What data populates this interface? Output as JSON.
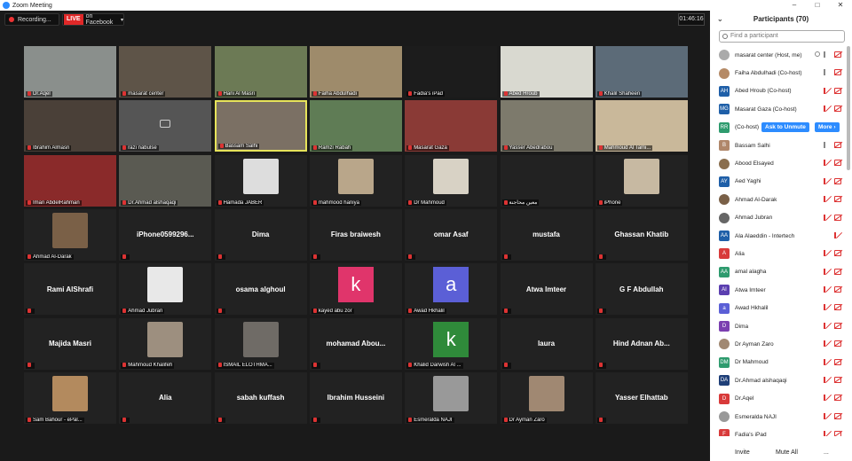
{
  "window": {
    "title": "Zoom Meeting",
    "controls": [
      "–",
      "□",
      "✕"
    ]
  },
  "topbar": {
    "recording": "Recording...",
    "live_tag": "LIVE",
    "live_target": "on Facebook",
    "timer": "01:46:16"
  },
  "tiles": [
    {
      "name": "Dr.Aqel",
      "type": "video",
      "color": "#8a8f8c"
    },
    {
      "name": "masarat center",
      "type": "video",
      "color": "#5e5448"
    },
    {
      "name": "Hani Al Masri",
      "type": "video",
      "color": "#6c7a55"
    },
    {
      "name": "Faiha Abdulhadi",
      "type": "video",
      "color": "#9e8b6b"
    },
    {
      "name": "Fadia's iPad",
      "type": "video",
      "color": "#1c1c1c"
    },
    {
      "name": "Abed Hroub",
      "type": "video",
      "color": "#d9d9d0"
    },
    {
      "name": "Khalil Shaheen",
      "type": "video",
      "color": "#5c6b78"
    },
    {
      "name": "Ibrahim Almasri",
      "type": "video",
      "color": "#4a4038"
    },
    {
      "name": "razi nabulse",
      "type": "camoff",
      "color": "#555"
    },
    {
      "name": "Bassam Salhi",
      "type": "video",
      "color": "#7b7064",
      "talking": true
    },
    {
      "name": "Ramzi Rabah",
      "type": "video",
      "color": "#5f7c55"
    },
    {
      "name": "Masarat Gaza",
      "type": "video",
      "color": "#8a3a36"
    },
    {
      "name": "Yasser Abedrabou",
      "type": "video",
      "color": "#7d7a6c"
    },
    {
      "name": "Mahmoud Al Tami...",
      "type": "video",
      "color": "#c9b89a"
    },
    {
      "name": "Iman AbdelRahman",
      "type": "video",
      "color": "#8a2a2a"
    },
    {
      "name": "Dr.Ahmad alshaqaqi",
      "type": "video",
      "color": "#5a5a52"
    },
    {
      "name": "Hamada JABER",
      "type": "photo",
      "color": "#ddd"
    },
    {
      "name": "mahmood haniya",
      "type": "photo",
      "color": "#b9a68a"
    },
    {
      "name": "Dr Mahmoud",
      "type": "photo",
      "color": "#d8d2c5"
    },
    {
      "name": "معين محاجنة",
      "type": "none"
    },
    {
      "name": "iPhone",
      "type": "photo",
      "color": "#c7b9a2"
    },
    {
      "name": "Ahmad Al-Darak",
      "type": "photo",
      "color": "#7a6047"
    },
    {
      "name": "iPhone0599296...",
      "type": "nameonly"
    },
    {
      "name": "Dima",
      "type": "nameonly"
    },
    {
      "name": "Firas braiwesh",
      "type": "nameonly"
    },
    {
      "name": "omar Asaf",
      "type": "nameonly"
    },
    {
      "name": "mustafa",
      "type": "nameonly"
    },
    {
      "name": "Ghassan Khatib",
      "type": "nameonly"
    },
    {
      "name": "Rami AlShrafi",
      "type": "nameonly"
    },
    {
      "name": "Ahmad Jubran",
      "type": "photo",
      "color": "#e8e8e8"
    },
    {
      "name": "osama alghoul",
      "type": "nameonly"
    },
    {
      "name": "kayed abu zor",
      "type": "letter",
      "letter": "k",
      "color": "#e0356b"
    },
    {
      "name": "Awad Hkhalil",
      "type": "letter",
      "letter": "a",
      "color": "#5b5fd6"
    },
    {
      "name": "Atwa Imteer",
      "type": "nameonly"
    },
    {
      "name": "G F Abdullah",
      "type": "nameonly"
    },
    {
      "name": "Majida Masri",
      "type": "nameonly"
    },
    {
      "name": "Mahmoud Khalifeh",
      "type": "photo",
      "color": "#9d8f7f"
    },
    {
      "name": "ISMAIL ELOTHMA...",
      "type": "photo",
      "color": "#6f6b66"
    },
    {
      "name": "mohamad  Abou...",
      "type": "nameonly"
    },
    {
      "name": "Khalid Darwish Al ...",
      "type": "letter",
      "letter": "k",
      "color": "#2f8a3a"
    },
    {
      "name": "laura",
      "type": "nameonly"
    },
    {
      "name": "Hind  Adnan  Ab...",
      "type": "nameonly"
    },
    {
      "name": "Sam Bahour - ePal...",
      "type": "photo",
      "color": "#b38a5e"
    },
    {
      "name": "Alia",
      "type": "nameonly"
    },
    {
      "name": "sabah kuffash",
      "type": "nameonly"
    },
    {
      "name": "Ibrahim Husseini",
      "type": "nameonly"
    },
    {
      "name": "Esmeralda NAJI",
      "type": "photo",
      "color": "#999"
    },
    {
      "name": "Dr Ayman Zaro",
      "type": "photo",
      "color": "#a08872"
    },
    {
      "name": "Yasser Elhattab",
      "type": "nameonly"
    }
  ],
  "sidebar": {
    "title": "Participants (70)",
    "search_placeholder": "Find a participant",
    "ask_unmute": "Ask to Unmute",
    "more": "More ›",
    "participants": [
      {
        "name": "masarat center (Host, me)",
        "avatar": "photo",
        "color": "#aaa",
        "mic": "on",
        "cam": "off",
        "extra": "record"
      },
      {
        "name": "Faiha Abdulhadi (Co-host)",
        "avatar": "photo",
        "color": "#b58a66",
        "mic": "on",
        "cam": "off"
      },
      {
        "name": "Abed Hroub (Co-host)",
        "avatar": "AH",
        "color": "#1f5fa8",
        "mic": "off",
        "cam": "off"
      },
      {
        "name": "Masarat Gaza (Co-host)",
        "avatar": "MG",
        "color": "#1f5fa8",
        "mic": "off",
        "cam": "off"
      },
      {
        "name": "(Co-host)",
        "avatar": "RR",
        "color": "#2e9b6e",
        "mic": "off",
        "cam": "off",
        "actions": true
      },
      {
        "name": "Bassam Salhi",
        "avatar": "B",
        "color": "#b0876a",
        "mic": "on",
        "cam": "off"
      },
      {
        "name": "Abood Elsayed",
        "avatar": "photo",
        "color": "#8a6e4e",
        "mic": "off",
        "cam": "off"
      },
      {
        "name": "Aed Yaghi",
        "avatar": "AY",
        "color": "#1f5fa8",
        "mic": "off",
        "cam": "off"
      },
      {
        "name": "Ahmad Al-Darak",
        "avatar": "photo",
        "color": "#7a6047",
        "mic": "off",
        "cam": "off"
      },
      {
        "name": "Ahmad Jubran",
        "avatar": "photo",
        "color": "#666",
        "mic": "off",
        "cam": "off"
      },
      {
        "name": "Ala Alaeddin - Intertech",
        "avatar": "AA",
        "color": "#1f5fa8",
        "mic": "off",
        "cam": "none"
      },
      {
        "name": "Alia",
        "avatar": "A",
        "color": "#d83a3a",
        "mic": "off",
        "cam": "off"
      },
      {
        "name": "amal alagha",
        "avatar": "AA",
        "color": "#2e9b6e",
        "mic": "off",
        "cam": "off"
      },
      {
        "name": "Atwa Imteer",
        "avatar": "AI",
        "color": "#5b3fb0",
        "mic": "off",
        "cam": "off"
      },
      {
        "name": "Awad Hkhalil",
        "avatar": "a",
        "color": "#5b5fd6",
        "mic": "off",
        "cam": "off"
      },
      {
        "name": "Dima",
        "avatar": "D",
        "color": "#7b3fb0",
        "mic": "off",
        "cam": "off"
      },
      {
        "name": "Dr Ayman Zaro",
        "avatar": "photo",
        "color": "#a08872",
        "mic": "off",
        "cam": "off"
      },
      {
        "name": "Dr Mahmoud",
        "avatar": "DM",
        "color": "#2e9b6e",
        "mic": "off",
        "cam": "off"
      },
      {
        "name": "Dr.Ahmad alshaqaqi",
        "avatar": "DA",
        "color": "#1f3f78",
        "mic": "off",
        "cam": "off"
      },
      {
        "name": "Dr.Aqel",
        "avatar": "D",
        "color": "#d83a3a",
        "mic": "off",
        "cam": "off"
      },
      {
        "name": "Esmeralda NAJI",
        "avatar": "photo",
        "color": "#999",
        "mic": "off",
        "cam": "off"
      },
      {
        "name": "Fadia's iPad",
        "avatar": "F",
        "color": "#d83a3a",
        "mic": "off",
        "cam": "off"
      }
    ],
    "footer": {
      "invite": "Invite",
      "mute_all": "Mute All",
      "more": "..."
    }
  }
}
